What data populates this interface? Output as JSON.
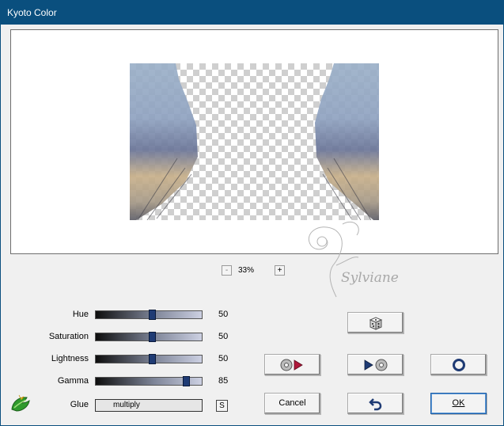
{
  "window": {
    "title": "Kyoto Color"
  },
  "preview": {
    "zoom_out_label": "-",
    "zoom_in_label": "+",
    "zoom_value": "33%",
    "watermark_text": "Sylviane"
  },
  "sliders": [
    {
      "label": "Hue",
      "value": "50",
      "level": 0.5
    },
    {
      "label": "Saturation",
      "value": "50",
      "level": 0.5
    },
    {
      "label": "Lightness",
      "value": "50",
      "level": 0.5
    },
    {
      "label": "Gamma",
      "value": "85",
      "level": 0.85
    }
  ],
  "glue": {
    "label": "Glue",
    "value": "multiply",
    "s_button_label": "S"
  },
  "buttons": {
    "randomize_icon": "dice-icon",
    "load_preset_icon": "load-preset-icon",
    "save_preset_icon": "save-preset-icon",
    "reset_icon": "reset-circle-icon",
    "cancel_label": "Cancel",
    "undo_icon": "undo-arrow-icon",
    "ok_label": "OK"
  },
  "colors": {
    "titlebar": "#0a4f7e",
    "slider_thumb": "#1f3b74",
    "accent_red": "#b0183b",
    "accent_navy": "#1f3b74"
  }
}
